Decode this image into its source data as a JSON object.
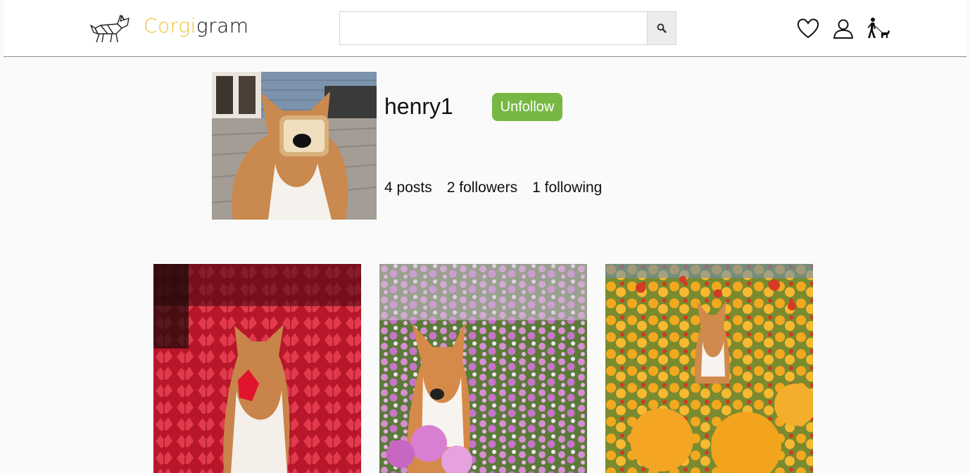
{
  "header": {
    "logo": {
      "part1": "Corgi",
      "part2": "gram",
      "icon": "corgi-logo-icon"
    },
    "search": {
      "value": "",
      "placeholder": "",
      "button_icon": "search-icon"
    },
    "nav_icons": [
      "heart-icon",
      "user-icon",
      "dog-walker-icon"
    ]
  },
  "profile": {
    "username": "henry1",
    "follow_button": "Unfollow",
    "stats": {
      "posts": "4 posts",
      "followers": "2 followers",
      "following": "1 following"
    }
  },
  "posts": [
    {
      "theme": "red-leaves"
    },
    {
      "theme": "pink-flowers"
    },
    {
      "theme": "orange-flowers"
    }
  ],
  "colors": {
    "logo_accent": "#f2c231",
    "button_green": "#77b844",
    "header_bg": "#ffffff",
    "page_bg": "#fafafa"
  }
}
